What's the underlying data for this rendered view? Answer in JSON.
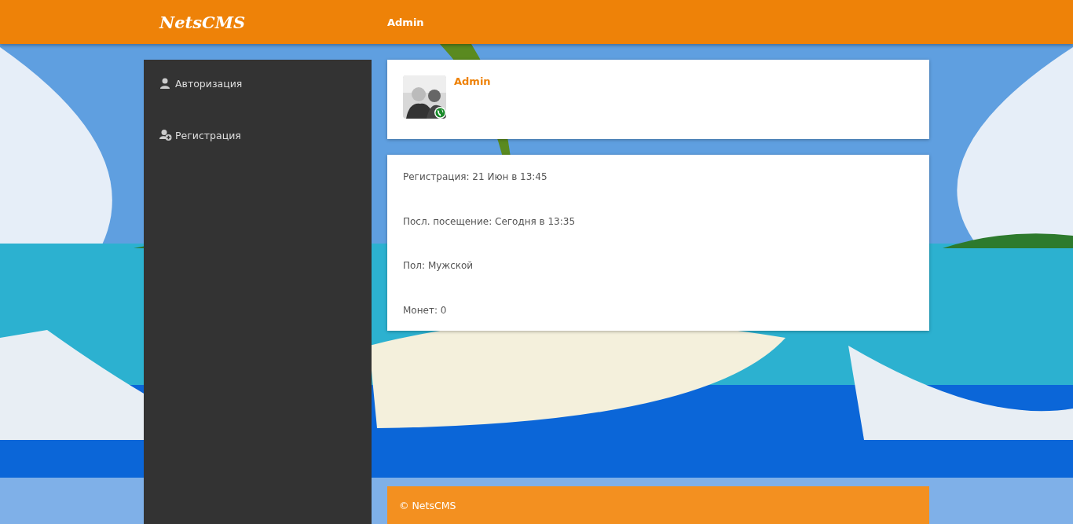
{
  "header": {
    "logo": "NetsCMS",
    "user": "Admin"
  },
  "sidebar": {
    "items": [
      {
        "label": "Авторизация",
        "kind": "login"
      },
      {
        "label": "Регистрация",
        "kind": "register"
      }
    ]
  },
  "profile": {
    "name": "Admin",
    "online": true
  },
  "details": [
    "Регистрация: 21 Июн в 13:45",
    "Посл. посещение: Сегодня в 13:35",
    "Пол: Мужской",
    "Монет: 0"
  ],
  "footer": {
    "text": "© NetsCMS"
  }
}
